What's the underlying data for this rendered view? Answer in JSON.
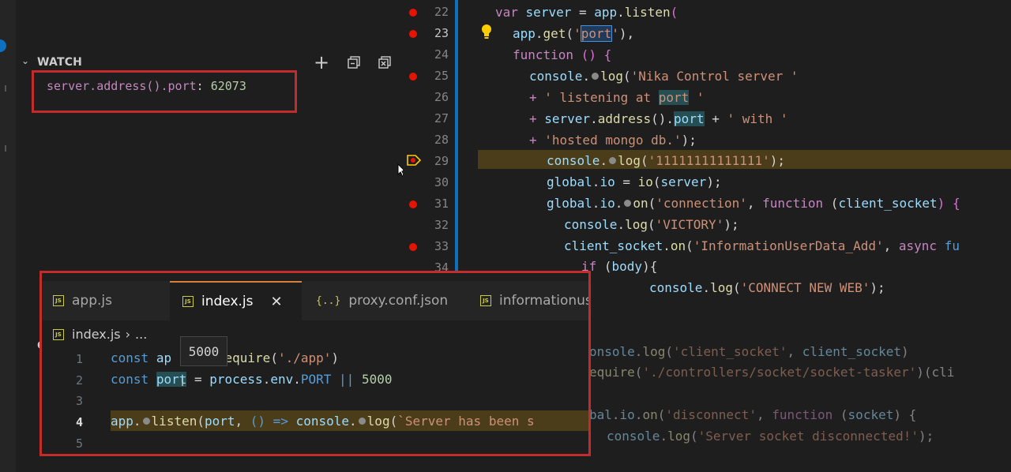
{
  "watch": {
    "title": "WATCH",
    "chevron": "⌄",
    "add_icon": "+",
    "expression": "server.address().port",
    "separator": ": ",
    "value": "62073"
  },
  "lower_panel": {
    "title_partial": "CA"
  },
  "editor": {
    "lines": [
      {
        "n": "22"
      },
      {
        "n": "23"
      },
      {
        "n": "24"
      },
      {
        "n": "25"
      },
      {
        "n": "26"
      },
      {
        "n": "27"
      },
      {
        "n": "28"
      },
      {
        "n": "29"
      },
      {
        "n": "30"
      },
      {
        "n": "31"
      },
      {
        "n": "32"
      },
      {
        "n": "33"
      },
      {
        "n": "34"
      }
    ],
    "code": {
      "l22": {
        "kw": "var",
        "id": "server",
        "op": " = ",
        "obj": "app",
        "fn": "listen",
        "paren": "("
      },
      "l23": {
        "obj": "app",
        "fn": "get",
        "q1": "'",
        "str": "port",
        "q2": "'",
        "rest": "),"
      },
      "l24": {
        "kw": "function",
        "rest": " () {"
      },
      "l25": {
        "obj": "console",
        "fn": "log",
        "str": "'Nika Control server '"
      },
      "l26": {
        "op": "+ ",
        "str1": "' listening at ",
        "str2": "port",
        "str3": " '"
      },
      "l27": {
        "op": "+ ",
        "obj": "server",
        "fn": "address",
        "paren": "().",
        "prop": "port",
        "op2": " + ",
        "str": "' with '"
      },
      "l28": {
        "op": "+ ",
        "str": "'hosted mongo db.'",
        "rest": ");"
      },
      "l29": {
        "obj": "console",
        "fn": "log",
        "str": "'11111111111111'",
        "rest": ");"
      },
      "l30": {
        "obj": "global",
        "prop": "io",
        "op": " = ",
        "fn": "io",
        "arg": "server",
        "rest": ");"
      },
      "l31": {
        "obj": "global",
        "prop": "io",
        "fn": "on",
        "str": "'connection'",
        "kw": "function",
        "arg": "client_socket",
        "rest": ") {"
      },
      "l32": {
        "obj": "console",
        "fn": "log",
        "str": "'VICTORY'",
        "rest": ");"
      },
      "l33": {
        "obj": "client_socket",
        "fn": "on",
        "str": "'InformationUserData_Add'",
        "kw": "async",
        "rest": "fu"
      },
      "l34": {
        "kw": "if",
        "arg": "body",
        "rest": "){"
      },
      "l35": {
        "obj": "console",
        "fn": "log",
        "str": "'CONNECT NEW WEB'",
        "rest": ");"
      },
      "bg1": {
        "obj": "onsole",
        "fn": "log",
        "str": "'client_socket'",
        "arg": "client_socket",
        "rest": ")"
      },
      "bg2": {
        "fn": "equire",
        "str": "'./controllers/socket/socket-tasker'",
        "rest": ")(cli"
      },
      "bg3": {
        "obj": "bal",
        "prop": "io",
        "fn": "on",
        "str": "'disconnect'",
        "kw": "function",
        "arg": "socket",
        "rest": ") {"
      },
      "bg4": {
        "obj": "console",
        "fn": "log",
        "str": "'Server socket disconnected!'",
        "rest": ");"
      }
    }
  },
  "peek": {
    "tabs": [
      {
        "label": "app.js",
        "icon": "JS"
      },
      {
        "label": "index.js",
        "icon": "JS"
      },
      {
        "label": "proxy.conf.json",
        "icon": "{..}"
      },
      {
        "label": "informationus",
        "icon": "JS"
      }
    ],
    "close_glyph": "✕",
    "breadcrumb": {
      "file": "index.js",
      "sep": "›",
      "more": "..."
    },
    "lines": [
      {
        "n": "1"
      },
      {
        "n": "2"
      },
      {
        "n": "3"
      },
      {
        "n": "4"
      },
      {
        "n": "5"
      }
    ],
    "code": {
      "p1": {
        "kw": "const",
        "id": "ap",
        "fn": "require",
        "str": "'./app'",
        "rest": ")"
      },
      "p2": {
        "kw": "const",
        "id": "port",
        "op": " = ",
        "obj": "process",
        "prop": "env",
        "const": "PORT",
        "op2": "||",
        "num": "5000"
      },
      "p4": {
        "obj": "app",
        "fn": "listen",
        "arg": "port",
        "arrow": "() =>",
        "obj2": "console",
        "fn2": "log",
        "str": "`Server has been s"
      }
    },
    "tooltip": "5000"
  }
}
